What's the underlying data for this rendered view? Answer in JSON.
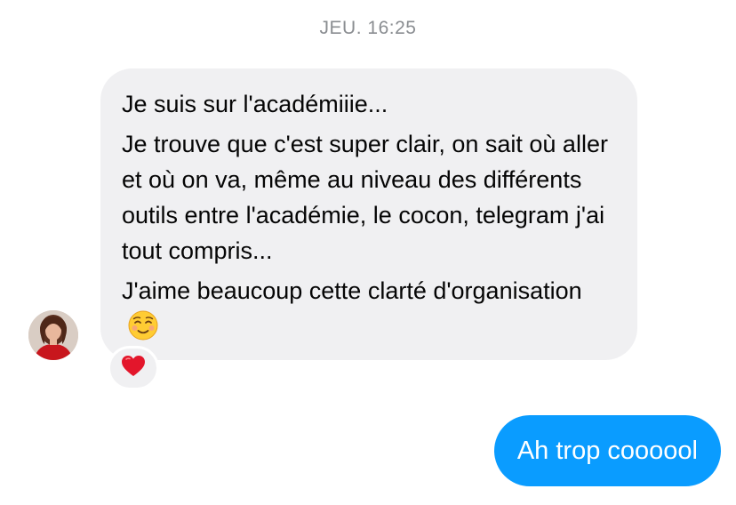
{
  "thread": {
    "timestamp": "JEU. 16:25"
  },
  "incoming_message": {
    "paragraphs": [
      "Je suis sur l'académiiie...",
      "Je trouve que c'est super clair, on sait où aller et où on va, même au niveau des différents outils entre l'académie, le cocon, telegram j'ai tout compris...",
      "J'aime beaucoup cette clarté d'organisation"
    ],
    "trailing_emoji": "smiling-face-emoji",
    "reaction": "red-heart-emoji",
    "sender_avatar": "avatar-photo"
  },
  "outgoing_message": {
    "text": "Ah trop coooool"
  },
  "colors": {
    "incoming_bubble": "#f0f0f2",
    "outgoing_bubble": "#0a9cff",
    "timestamp": "#8a8d91",
    "heart": "#e3162b"
  }
}
